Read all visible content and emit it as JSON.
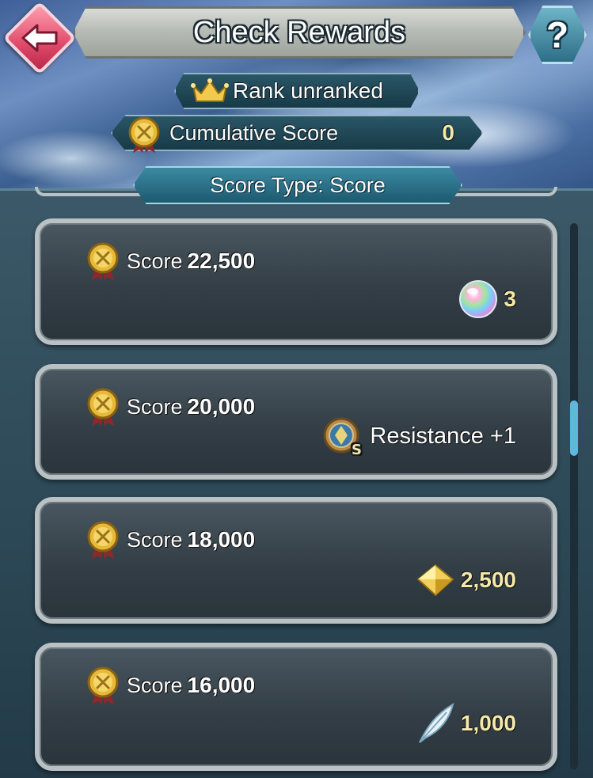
{
  "header": {
    "title": "Check Rewards",
    "help_label": "?"
  },
  "rank": {
    "label": "Rank unranked"
  },
  "cumulative": {
    "label": "Cumulative Score",
    "value": "0"
  },
  "score_type": {
    "label": "Score Type: Score"
  },
  "rewards": [
    {
      "score_label": "Score",
      "score_value": "22,500",
      "reward_icon": "orb-icon",
      "reward_text": "3"
    },
    {
      "score_label": "Score",
      "score_value": "20,000",
      "reward_icon": "seal-skill-icon",
      "reward_text": "Resistance +1",
      "skill_badge": "S"
    },
    {
      "score_label": "Score",
      "score_value": "18,000",
      "reward_icon": "divine-dew-crystal-icon",
      "reward_text": "2,500"
    },
    {
      "score_label": "Score",
      "score_value": "16,000",
      "reward_icon": "feather-icon",
      "reward_text": "1,000"
    }
  ],
  "colors": {
    "accent_gold": "#f4e9a8",
    "back_pink": "#e04a6a",
    "help_teal": "#2c6e86",
    "scroll_thumb": "#5fb8dc"
  }
}
